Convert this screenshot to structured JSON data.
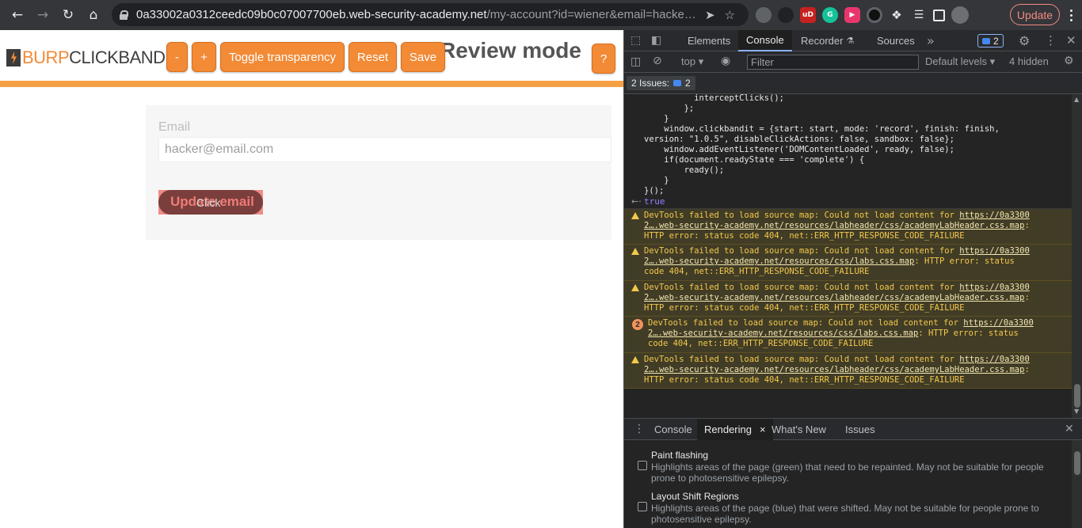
{
  "browser": {
    "url_host": "0a33002a0312ceedc09b0c07007700eb.web-security-academy.net",
    "url_path": "/my-account?id=wiener&email=hacke…",
    "update_label": "Update"
  },
  "clickbandit": {
    "logo_burp": "BURP",
    "logo_clickbandit": "CLICKBANDIT",
    "title": "Review mode",
    "buttons": {
      "minus": "-",
      "plus": "+",
      "toggle": "Toggle transparency",
      "reset": "Reset",
      "save": "Save",
      "help": "?"
    },
    "colors": {
      "accent": "#f28a36",
      "header_rule": "#f6a046"
    }
  },
  "page": {
    "email_label": "Email",
    "email_placeholder": "hacker@email.com",
    "update_button": "Update email",
    "click_overlay": "Click"
  },
  "devtools": {
    "tabs": [
      "Elements",
      "Console",
      "Recorder",
      "Sources"
    ],
    "issue_badge_count": "2",
    "context": "top",
    "filter_placeholder": "Filter",
    "levels": "Default levels",
    "hidden": "4 hidden",
    "issues_label": "2 Issues:",
    "issues_count": "2",
    "code_lines": "          interceptClicks();\n        };\n    }\n    window.clickbandit = {start: start, mode: 'record', finish: finish,\nversion: \"1.0.5\", disableClickActions: false, sandbox: false};\n    window.addEventListener('DOMContentLoaded', ready, false);\n    if(document.readyState === 'complete') {\n        ready();\n    }\n}();",
    "return_value": "true",
    "messages": [
      {
        "kind": "warn",
        "prefix": "DevTools failed to load source map: Could not load content for ",
        "link1": "https://0a3300",
        "link2": "2….web-security-academy.net/resources/labheader/css/academyLabHeader.css.map",
        "suffix": ":",
        "tail": "HTTP error: status code 404, net::ERR_HTTP_RESPONSE_CODE_FAILURE"
      },
      {
        "kind": "warn",
        "prefix": "DevTools failed to load source map: Could not load content for ",
        "link1": "https://0a3300",
        "link2": "2….web-security-academy.net/resources/css/labs.css.map",
        "suffix": ": HTTP error: status",
        "tail": "code 404, net::ERR_HTTP_RESPONSE_CODE_FAILURE"
      },
      {
        "kind": "warn",
        "prefix": "DevTools failed to load source map: Could not load content for ",
        "link1": "https://0a3300",
        "link2": "2….web-security-academy.net/resources/labheader/css/academyLabHeader.css.map",
        "suffix": ":",
        "tail": "HTTP error: status code 404, net::ERR_HTTP_RESPONSE_CODE_FAILURE"
      },
      {
        "kind": "warn-repeat",
        "count": "2",
        "prefix": "DevTools failed to load source map: Could not load content for ",
        "link1": "https://0a3300",
        "link2": "2….web-security-academy.net/resources/css/labs.css.map",
        "suffix": ": HTTP error: status",
        "tail": "code 404, net::ERR_HTTP_RESPONSE_CODE_FAILURE"
      },
      {
        "kind": "warn",
        "prefix": "DevTools failed to load source map: Could not load content for ",
        "link1": "https://0a3300",
        "link2": "2….web-security-academy.net/resources/labheader/css/academyLabHeader.css.map",
        "suffix": ":",
        "tail": "HTTP error: status code 404, net::ERR_HTTP_RESPONSE_CODE_FAILURE"
      }
    ],
    "drawer_tabs": [
      "Console",
      "Rendering",
      "What's New",
      "Issues"
    ],
    "rendering": [
      {
        "title": "Paint flashing",
        "desc1": "Highlights areas of the page (green) that need to be repainted. May not be suitable for people",
        "desc2": "prone to photosensitive epilepsy."
      },
      {
        "title": "Layout Shift Regions",
        "desc1": "Highlights areas of the page (blue) that were shifted. May not be suitable for people prone to",
        "desc2": "photosensitive epilepsy."
      }
    ],
    "colors": {
      "warn_bg": "#413c26",
      "warn_text": "#f2c94c",
      "link_blue": "#8ab4f8"
    }
  }
}
